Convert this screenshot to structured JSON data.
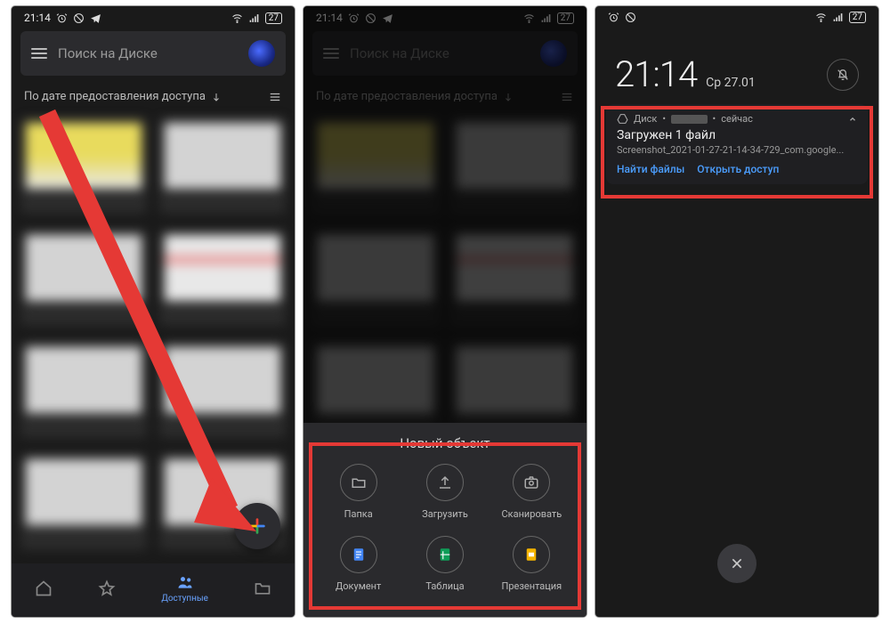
{
  "statusbar": {
    "time": "21:14",
    "battery": "27"
  },
  "search": {
    "placeholder": "Поиск на Диске"
  },
  "sort": {
    "label": "По дате предоставления доступа"
  },
  "nav": {
    "active_label": "Доступные"
  },
  "sheet": {
    "title": "Новый объект",
    "items": [
      {
        "label": "Папка"
      },
      {
        "label": "Загрузить"
      },
      {
        "label": "Сканировать"
      },
      {
        "label": "Документ"
      },
      {
        "label": "Таблица"
      },
      {
        "label": "Презентация"
      }
    ]
  },
  "lock": {
    "time": "21:14",
    "date": "Ср 27.01"
  },
  "notif": {
    "app": "Диск",
    "time": "сейчас",
    "title": "Загружен 1 файл",
    "body": "Screenshot_2021-01-27-21-14-34-729_com.google...",
    "action1": "Найти файлы",
    "action2": "Открыть доступ"
  }
}
